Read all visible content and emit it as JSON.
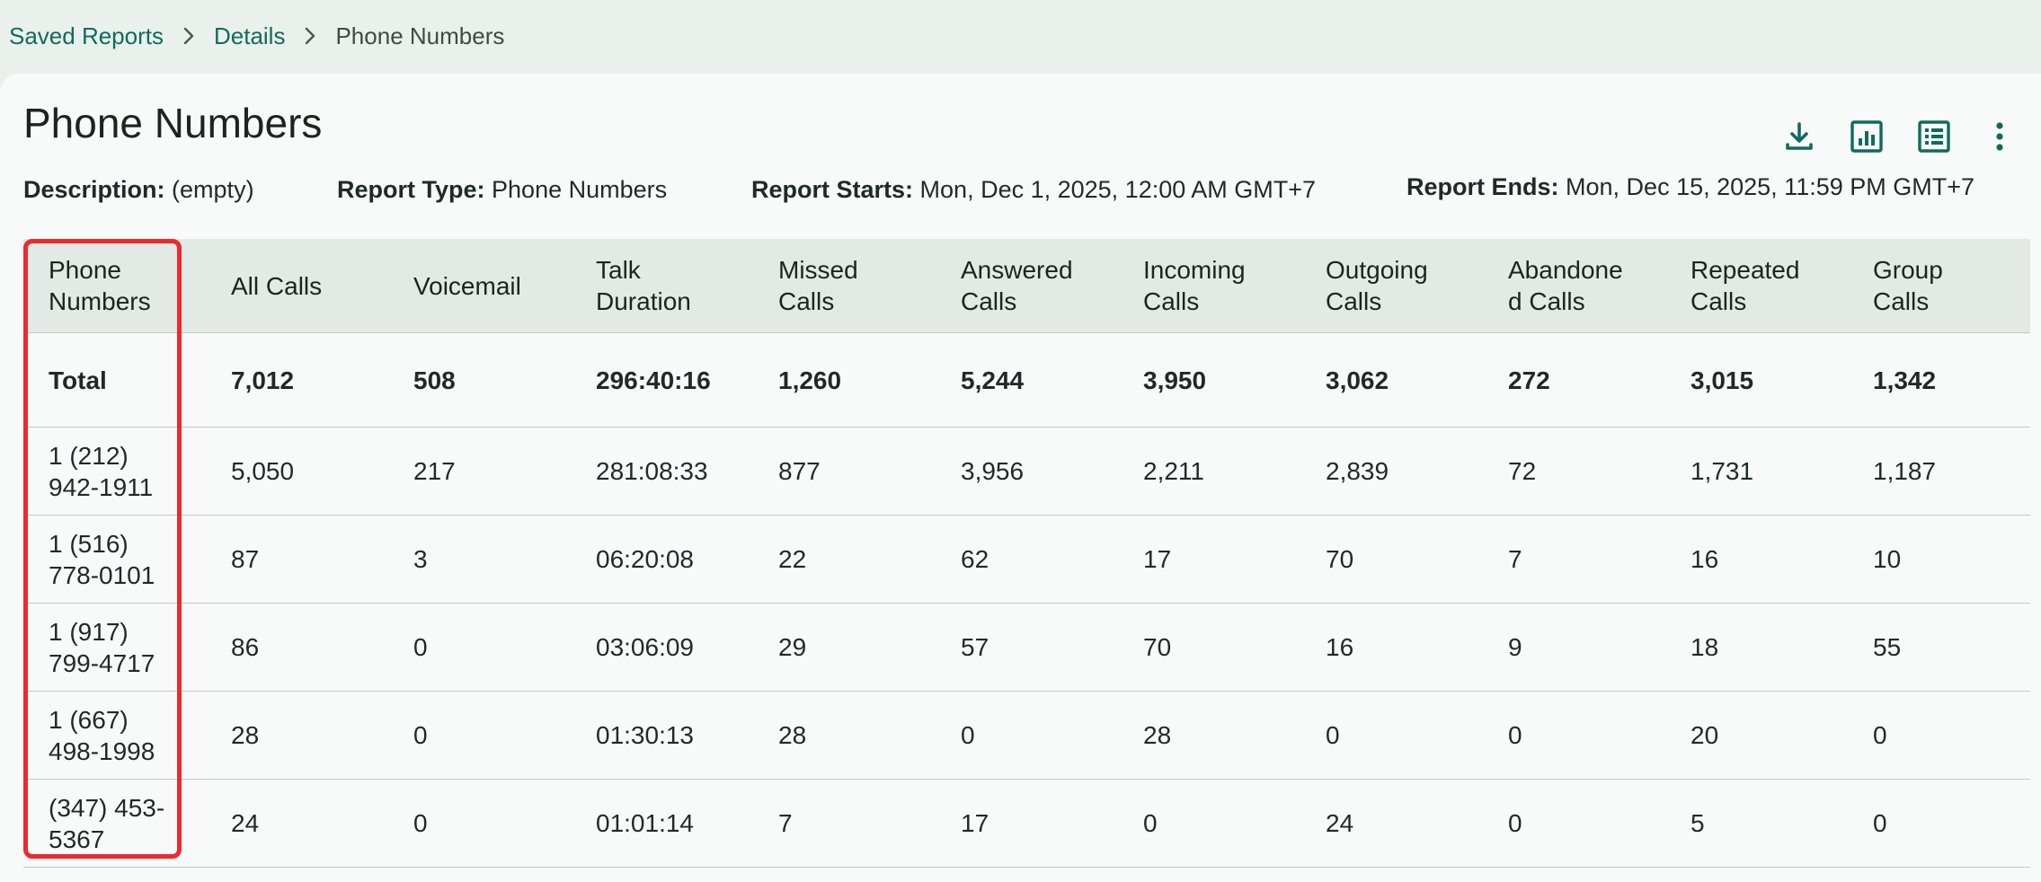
{
  "breadcrumb": {
    "items": [
      "Saved Reports",
      "Details"
    ],
    "current": "Phone Numbers"
  },
  "page": {
    "title": "Phone Numbers"
  },
  "meta": {
    "description_label": "Description:",
    "description_value": "(empty)",
    "report_type_label": "Report Type:",
    "report_type_value": "Phone Numbers",
    "report_starts_label": "Report Starts:",
    "report_starts_value": "Mon, Dec 1, 2025, 12:00 AM GMT+7",
    "report_ends_label": "Report Ends:",
    "report_ends_value": "Mon, Dec 15, 2025, 11:59 PM GMT+7"
  },
  "toolbar": {
    "icons": [
      "download-icon",
      "bar-chart-icon",
      "table-list-icon",
      "more-vertical-icon"
    ]
  },
  "colors": {
    "accent": "#0f6b5c",
    "highlight": "#ec2a2f"
  },
  "table": {
    "headers": [
      [
        "Phone",
        "Numbers"
      ],
      [
        "All Calls"
      ],
      [
        "Voicemail"
      ],
      [
        "Talk",
        "Duration"
      ],
      [
        "Missed",
        "Calls"
      ],
      [
        "Answered",
        "Calls"
      ],
      [
        "Incoming",
        "Calls"
      ],
      [
        "Outgoing",
        "Calls"
      ],
      [
        "Abandone",
        "d Calls"
      ],
      [
        "Repeated",
        "Calls"
      ],
      [
        "Group",
        "Calls"
      ]
    ],
    "total": [
      "Total",
      "7,012",
      "508",
      "296:40:16",
      "1,260",
      "5,244",
      "3,950",
      "3,062",
      "272",
      "3,015",
      "1,342"
    ],
    "rows": [
      [
        [
          "1 (212)",
          "942-1911"
        ],
        "5,050",
        "217",
        "281:08:33",
        "877",
        "3,956",
        "2,211",
        "2,839",
        "72",
        "1,731",
        "1,187"
      ],
      [
        [
          "1 (516)",
          "778-0101"
        ],
        "87",
        "3",
        "06:20:08",
        "22",
        "62",
        "17",
        "70",
        "7",
        "16",
        "10"
      ],
      [
        [
          "1 (917)",
          "799-4717"
        ],
        "86",
        "0",
        "03:06:09",
        "29",
        "57",
        "70",
        "16",
        "9",
        "18",
        "55"
      ],
      [
        [
          "1 (667)",
          "498-1998"
        ],
        "28",
        "0",
        "01:30:13",
        "28",
        "0",
        "28",
        "0",
        "0",
        "20",
        "0"
      ],
      [
        [
          "(347) 453-",
          "5367"
        ],
        "24",
        "0",
        "01:01:14",
        "7",
        "17",
        "0",
        "24",
        "0",
        "5",
        "0"
      ]
    ]
  }
}
